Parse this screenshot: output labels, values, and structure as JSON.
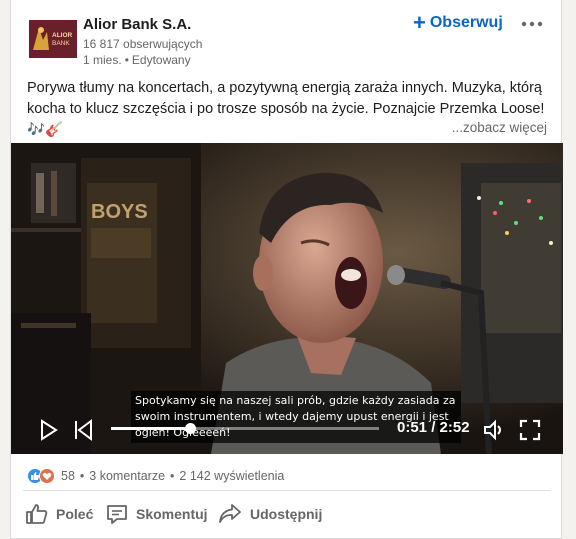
{
  "post": {
    "author": "Alior Bank S.A.",
    "logo_text": "ALIOR BANK",
    "followers": "16 817 obserwujących",
    "age": "1 mies.",
    "edited": "Edytowany",
    "dot": "•",
    "follow_label": "Obserwuj",
    "follow_plus": "+",
    "text": "Porywa tłumy na koncertach, a pozytywną energią zaraża innych. Muzyka, którą kocha to klucz szczęścia i po trosze sposób na życie. Poznajcie Przemka Loose! 🎶🎸",
    "see_more": "...zobacz więcej"
  },
  "video": {
    "subtitle": "Spotykamy się na naszej sali prób, gdzie każdy zasiada za swoim instrumentem, i wtedy dajemy upust energii i jest ogień! Ogieeeeń!",
    "time": "0:51 / 2:52",
    "progress": 0.2965,
    "icons": [
      "play-icon",
      "rewind-icon",
      "volume-icon",
      "fullscreen-icon"
    ]
  },
  "social": {
    "reactions_count": "58",
    "comments": "3 komentarze",
    "views": "2 142 wyświetlenia",
    "sep": "•",
    "reaction_icons": [
      "like-icon",
      "love-icon"
    ]
  },
  "actions": {
    "like": "Poleć",
    "comment": "Skomentuj",
    "share": "Udostępnij"
  },
  "colors": {
    "accent": "#0a66c2",
    "logo_bg": "#6a1f2b",
    "like": "#378fe9",
    "love": "#df704d"
  }
}
